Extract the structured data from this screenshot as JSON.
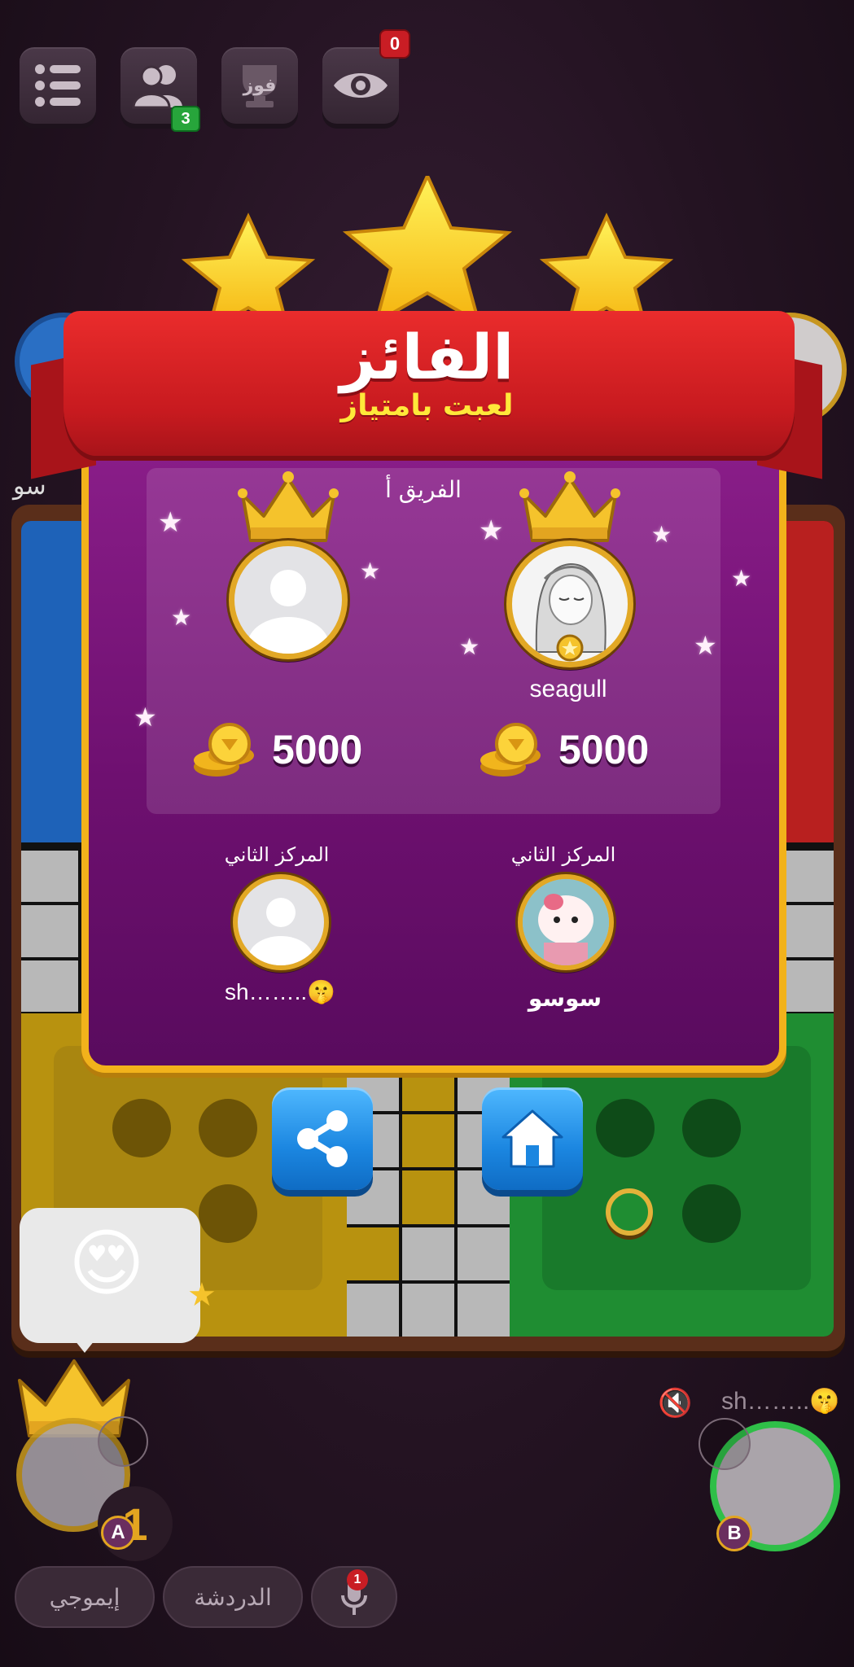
{
  "toolbar": {
    "menu_icon": "menu-icon",
    "friends_icon": "friends-icon",
    "friends_count": "3",
    "trophy_label": "فوز",
    "spectate_icon": "eye-icon",
    "spectators_count": "0"
  },
  "result": {
    "title": "الفائز",
    "subtitle": "لعبت بامتياز",
    "team_label": "الفريق أ",
    "winners": [
      {
        "name": "",
        "coins": "5000"
      },
      {
        "name": "seagull",
        "coins": "5000"
      }
    ],
    "runners_up": [
      {
        "rank_label": "المركز الثاني",
        "name": "sh……..🤫"
      },
      {
        "rank_label": "المركز الثاني",
        "name": "سوسو"
      }
    ]
  },
  "actions": {
    "share_icon": "share-icon",
    "home_icon": "home-icon"
  },
  "board": {
    "left_player_name_partial": "سو",
    "reaction_emoji": "😍",
    "opponent_name": "sh……..🤫",
    "player_a_badge": "A",
    "player_b_badge": "B",
    "player_a_rank": "1"
  },
  "bottom_bar": {
    "emoji_label": "إيموجي",
    "chat_label": "الدردشة",
    "mic_badge": "1"
  },
  "colors": {
    "ribbon_red": "#c71a1f",
    "modal_purple": "#7a1479",
    "gold": "#f2b21b",
    "button_blue": "#1b86e0"
  }
}
